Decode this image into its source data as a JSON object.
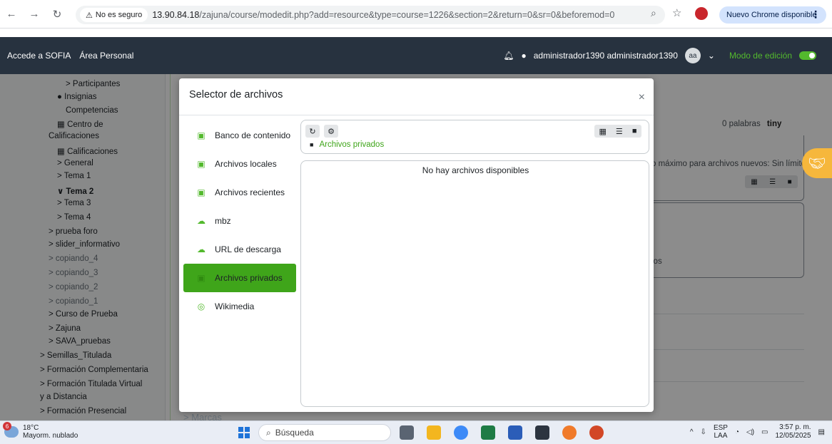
{
  "browser": {
    "security_label": "No es seguro",
    "url_host": "13.90.84.18",
    "url_path": "/zajuna/course/modedit.php?add=resource&type=course=1226&section=2&return=0&sr=0&beforemod=0",
    "update_label": "Nuevo Chrome disponible"
  },
  "navbar": {
    "link1": "Accede a SOFIA",
    "link2": "Área Personal",
    "user": "administrador1390 administrador1390",
    "avatar": "aa",
    "edit_mode": "Modo de edición"
  },
  "drawer": {
    "items": [
      {
        "label": "> Participantes"
      },
      {
        "label": "Insignias"
      },
      {
        "label": "Competencias"
      },
      {
        "label": "Centro de"
      },
      {
        "label": "Calificaciones"
      },
      {
        "label": "Calificaciones"
      },
      {
        "label": "> General"
      },
      {
        "label": "> Tema 1"
      },
      {
        "label": "∨ Tema 2"
      },
      {
        "label": "> Tema 3"
      },
      {
        "label": "> Tema 4"
      },
      {
        "label": "> prueba foro"
      },
      {
        "label": "> slider_informativo"
      },
      {
        "label": "> copiando_4"
      },
      {
        "label": "> copiando_3"
      },
      {
        "label": "> copiando_2"
      },
      {
        "label": "> copiando_1"
      },
      {
        "label": "> Curso de Prueba"
      },
      {
        "label": "> Zajuna"
      },
      {
        "label": "> SAVA_pruebas"
      },
      {
        "label": "> Semillas_Titulada"
      },
      {
        "label": "> Formación Complementaria"
      },
      {
        "label": "> Formación Titulada Virtual"
      },
      {
        "label": "y a Distancia"
      },
      {
        "label": "> Formación Presencial"
      }
    ]
  },
  "background": {
    "words": "0 palabras",
    "tiny": "tiny",
    "max_size": "o máximo para archivos nuevos: Sin límite",
    "los": "los",
    "marcas": "> Marcas"
  },
  "modal": {
    "title": "Selector de archivos",
    "close": "×",
    "repositories": [
      {
        "label": "Banco de contenido",
        "icon": "repository-icon"
      },
      {
        "label": "Archivos locales",
        "icon": "repository-icon"
      },
      {
        "label": "Archivos recientes",
        "icon": "repository-icon"
      },
      {
        "label": "mbz",
        "icon": "cloud-upload-icon"
      },
      {
        "label": "URL de descarga",
        "icon": "cloud-upload-icon"
      },
      {
        "label": "Archivos privados",
        "icon": "repository-icon",
        "active": true
      },
      {
        "label": "Wikimedia",
        "icon": "wikimedia-icon"
      }
    ],
    "breadcrumb": "Archivos privados",
    "empty_message": "No hay archivos disponibles"
  },
  "taskbar": {
    "weather_temp": "18°C",
    "weather_desc": "Mayorm. nublado",
    "weather_badge": "6",
    "search_label": "Búsqueda",
    "lang1": "ESP",
    "lang2": "LAA",
    "time": "3:57 p. m.",
    "date": "12/05/2025"
  },
  "colors": {
    "navbar": "#27323f",
    "accent_green": "#3fa51a",
    "edit_toggle": "#53b92d"
  }
}
